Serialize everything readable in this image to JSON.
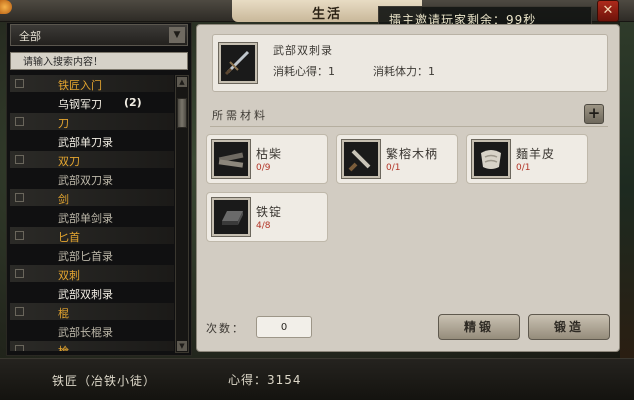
{
  "window": {
    "title": "生活",
    "invite_text": "擂主邀请玩家剩余：99秒",
    "close_label": "✕"
  },
  "sidebar": {
    "filter_value": "全部",
    "filter_arrow": "▼",
    "search_placeholder": "请输入搜索内容！",
    "tree": [
      {
        "type": "cat",
        "label": "铁匠入门"
      },
      {
        "type": "item",
        "label": "乌钢军刀",
        "count": "(2)",
        "selected": true
      },
      {
        "type": "cat",
        "label": "刀"
      },
      {
        "type": "item",
        "label": "武部单刀录",
        "selected": true
      },
      {
        "type": "cat",
        "label": "双刀"
      },
      {
        "type": "item",
        "label": "武部双刀录"
      },
      {
        "type": "cat",
        "label": "剑"
      },
      {
        "type": "item",
        "label": "武部单剑录"
      },
      {
        "type": "cat",
        "label": "匕首"
      },
      {
        "type": "item",
        "label": "武部匕首录"
      },
      {
        "type": "cat",
        "label": "双刺"
      },
      {
        "type": "item",
        "label": "武部双刺录",
        "selected": true
      },
      {
        "type": "cat",
        "label": "棍"
      },
      {
        "type": "item",
        "label": "武部长棍录"
      },
      {
        "type": "cat",
        "label": "槍"
      }
    ],
    "scroll_up": "▲",
    "scroll_down": "▼"
  },
  "recipe": {
    "name": "武部双刺录",
    "xinde_cost": "消耗心得：1",
    "tili_cost": "消耗体力：1",
    "icon": "dagger-icon"
  },
  "materials": {
    "label": "所需材料",
    "add_label": "+",
    "items": [
      {
        "name": "枯柴",
        "count": "0/9",
        "icon": "firewood-icon"
      },
      {
        "name": "繁榕木柄",
        "count": "0/1",
        "icon": "wooden-handle-icon"
      },
      {
        "name": "麵羊皮",
        "count": "0/1",
        "icon": "sheepskin-icon"
      },
      {
        "name": "铁锭",
        "count": "4/8",
        "icon": "iron-ingot-icon"
      }
    ]
  },
  "controls": {
    "count_label": "次数：",
    "count_value": "0",
    "refine_label": "精锻",
    "forge_label": "锻造"
  },
  "footer": {
    "role": "铁匠（冶铁小徒）",
    "xinde": "心得：3154"
  },
  "colors": {
    "category": "#e4a52f",
    "material_count": "#b33527"
  }
}
